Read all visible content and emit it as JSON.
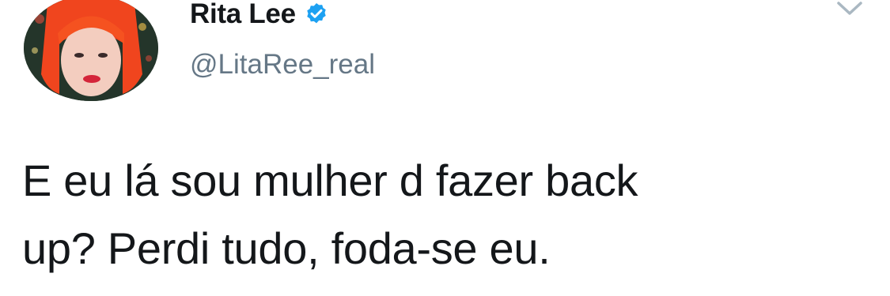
{
  "tweet": {
    "author": {
      "display_name": "Rita Lee",
      "handle": "@LitaRee_real",
      "verified": true,
      "avatar_icon": "profile-photo-red-hair"
    },
    "menu_icon": "chevron-down-icon",
    "text_lines": [
      "E eu lá sou mulher d fazer back",
      "up? Perdi tudo, foda-se eu."
    ]
  },
  "colors": {
    "verified_blue": "#1da1f2",
    "handle_gray": "#657786",
    "text": "#14171a",
    "caret_gray": "#aab8c2"
  }
}
